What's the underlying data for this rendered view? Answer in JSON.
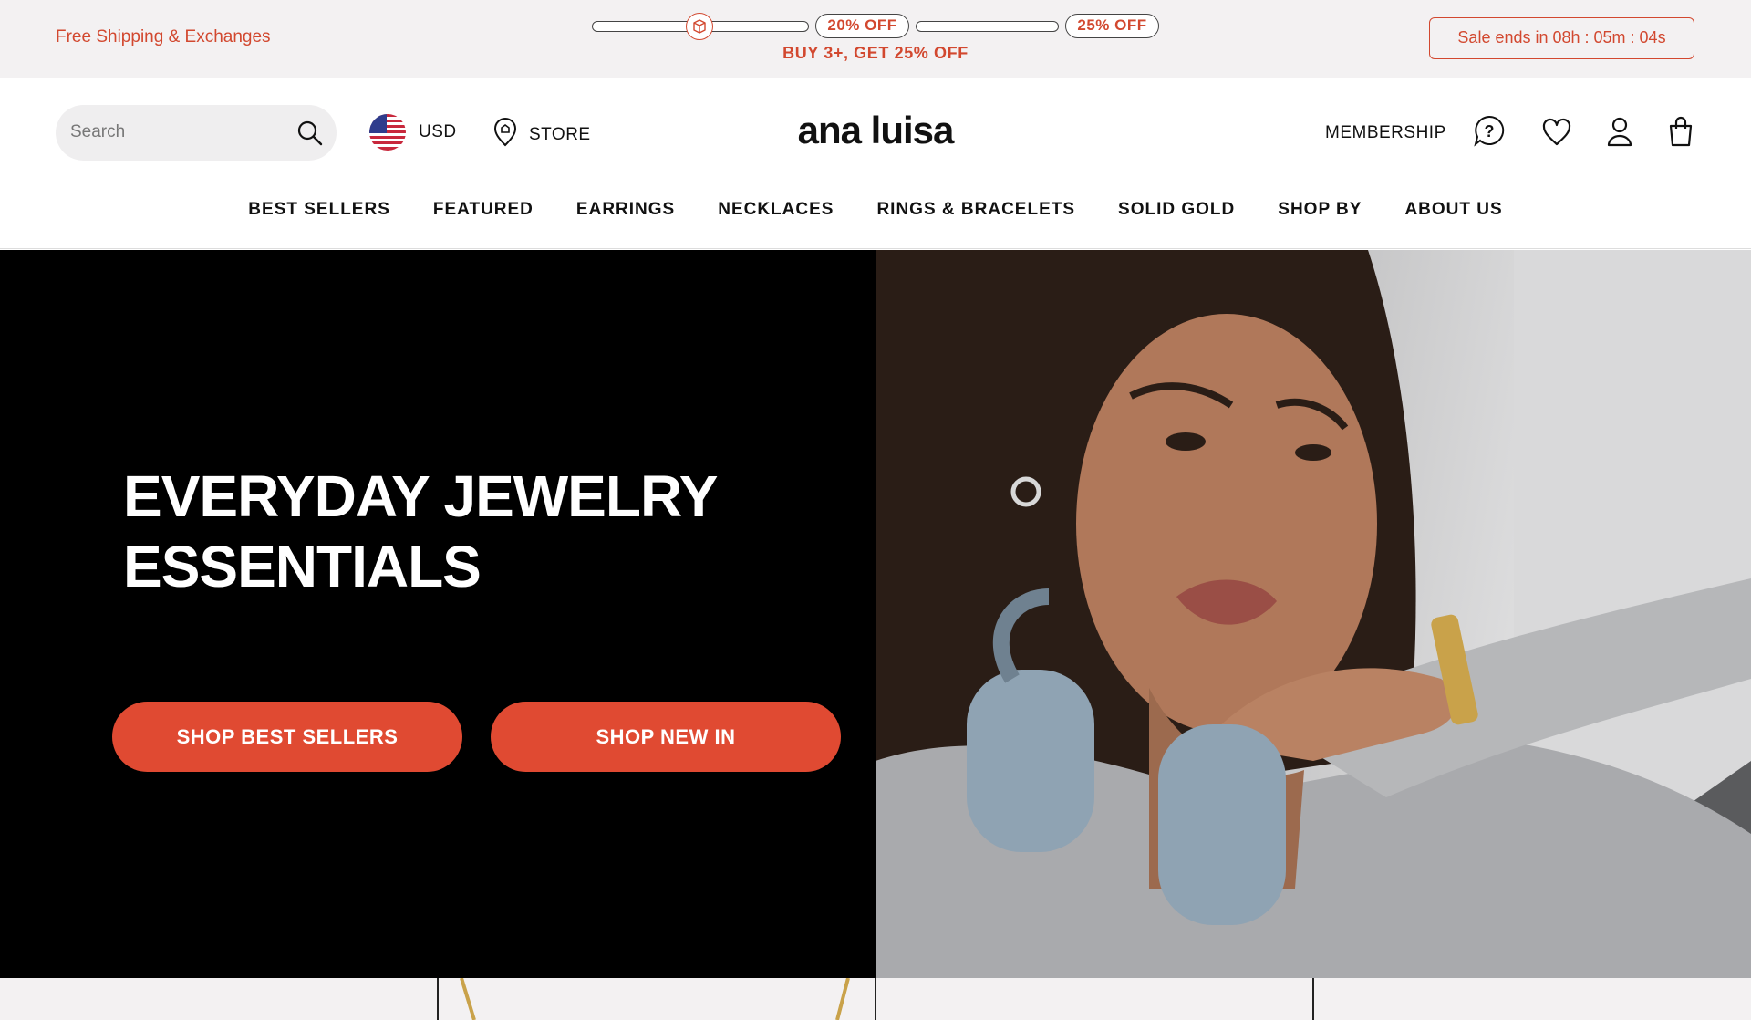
{
  "promo": {
    "shipping": "Free Shipping & Exchanges",
    "tier1": "20% OFF",
    "tier2": "25% OFF",
    "deal": "BUY 3+, GET 25% OFF",
    "sale_timer": "Sale ends in 08h : 05m : 04s"
  },
  "header": {
    "search_placeholder": "Search",
    "currency": "USD",
    "store": "STORE",
    "logo": "ana luisa",
    "membership": "MEMBERSHIP"
  },
  "nav": [
    "BEST SELLERS",
    "FEATURED",
    "EARRINGS",
    "NECKLACES",
    "RINGS & BRACELETS",
    "SOLID GOLD",
    "SHOP BY",
    "ABOUT US"
  ],
  "hero": {
    "title_line1": "EVERYDAY JEWELRY",
    "title_line2": "ESSENTIALS",
    "cta1": "SHOP BEST SELLERS",
    "cta2": "SHOP NEW IN"
  },
  "icons": [
    "box-icon",
    "search-icon",
    "us-flag-icon",
    "store-pin-icon",
    "help-icon",
    "heart-icon",
    "user-icon",
    "bag-icon"
  ],
  "colors": {
    "accent": "#e04a32",
    "promo_text": "#d2482f",
    "promo_bg": "#f3f1f2"
  }
}
